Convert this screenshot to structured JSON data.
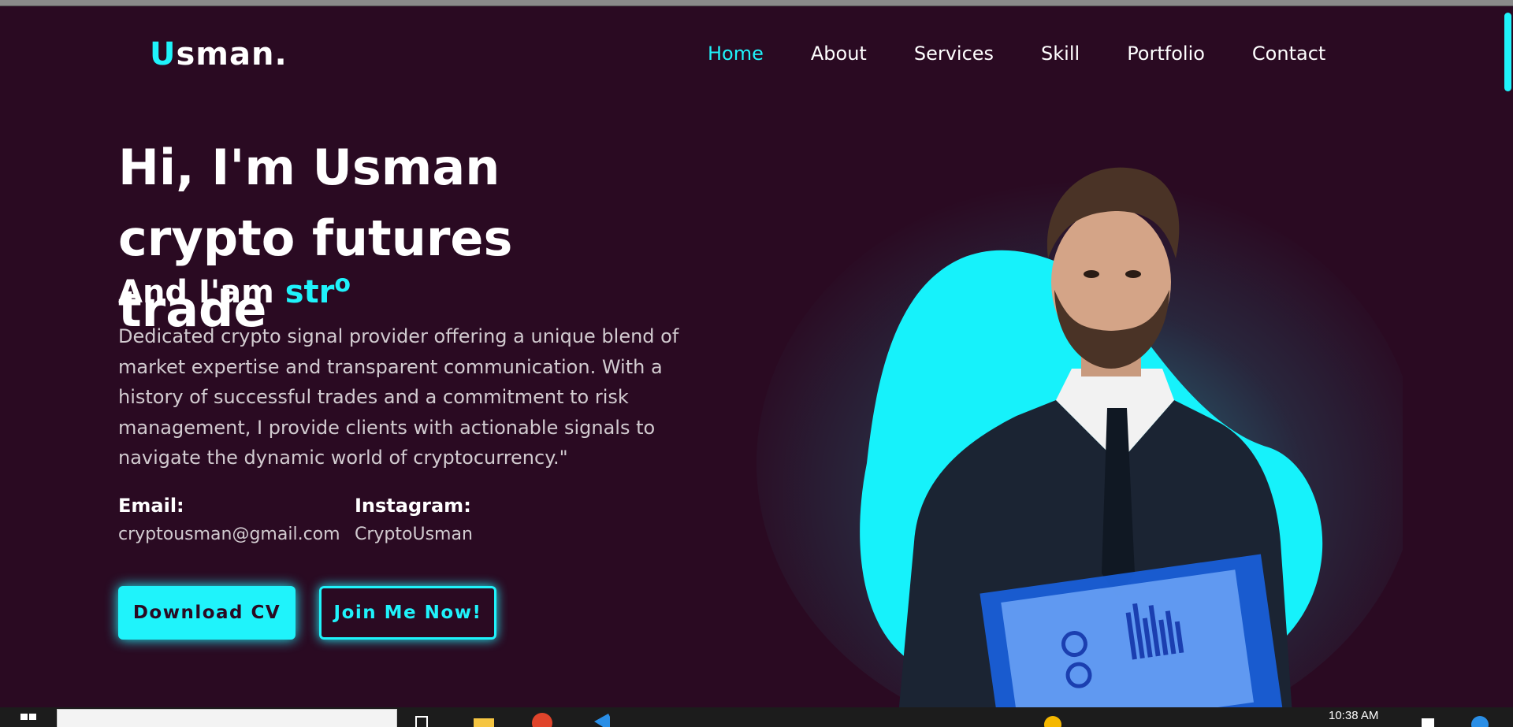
{
  "brand": {
    "logo_accent": "U",
    "logo_rest": "sman."
  },
  "nav": {
    "items": [
      {
        "label": "Home",
        "active": true
      },
      {
        "label": "About"
      },
      {
        "label": "Services"
      },
      {
        "label": "Skill"
      },
      {
        "label": "Portfolio"
      },
      {
        "label": "Contact"
      }
    ]
  },
  "hero": {
    "title": "Hi, I'm Usman crypto futures trade",
    "sub_prefix": "And I'am ",
    "typed_text": "str",
    "typed_raised": "o",
    "description": "Dedicated crypto signal provider offering a unique blend of market expertise and transparent communication. With a history of successful trades and a commitment to risk management, I provide clients with actionable signals to navigate the dynamic world of cryptocurrency.\""
  },
  "contacts": {
    "email_label": "Email:",
    "email_value": "cryptousman@gmail.com",
    "instagram_label": "Instagram:",
    "instagram_value": "CryptoUsman"
  },
  "buttons": {
    "download_cv": "Download CV",
    "join_me": "Join Me Now!"
  },
  "taskbar": {
    "clock": "10:38 AM"
  },
  "colors": {
    "background": "#2a0a22",
    "accent": "#1ff3fb",
    "text": "#ffffff",
    "muted_text": "#d2cbd0"
  }
}
